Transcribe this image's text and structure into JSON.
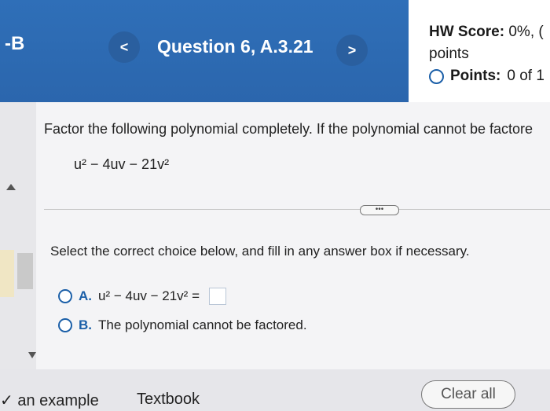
{
  "header": {
    "section_code": "-B",
    "prev_label": "<",
    "next_label": ">",
    "question_title": "Question 6, A.3.21"
  },
  "score": {
    "hw_label": "HW Score:",
    "hw_value": "0%, (",
    "points_word": "points",
    "points_label": "Points:",
    "points_value": "0 of 1"
  },
  "question": {
    "prompt": "Factor the following polynomial completely. If the polynomial cannot be factore",
    "polynomial": "u² − 4uv − 21v²",
    "more_label": "•••",
    "instruction": "Select the correct choice below, and fill in any answer box if necessary."
  },
  "choices": [
    {
      "letter": "A.",
      "text": "u² − 4uv − 21v² ="
    },
    {
      "letter": "B.",
      "text": "The polynomial cannot be factored."
    }
  ],
  "footer": {
    "example_label": "an example",
    "textbook_label": "Textbook",
    "clear_label": "Clear all"
  }
}
